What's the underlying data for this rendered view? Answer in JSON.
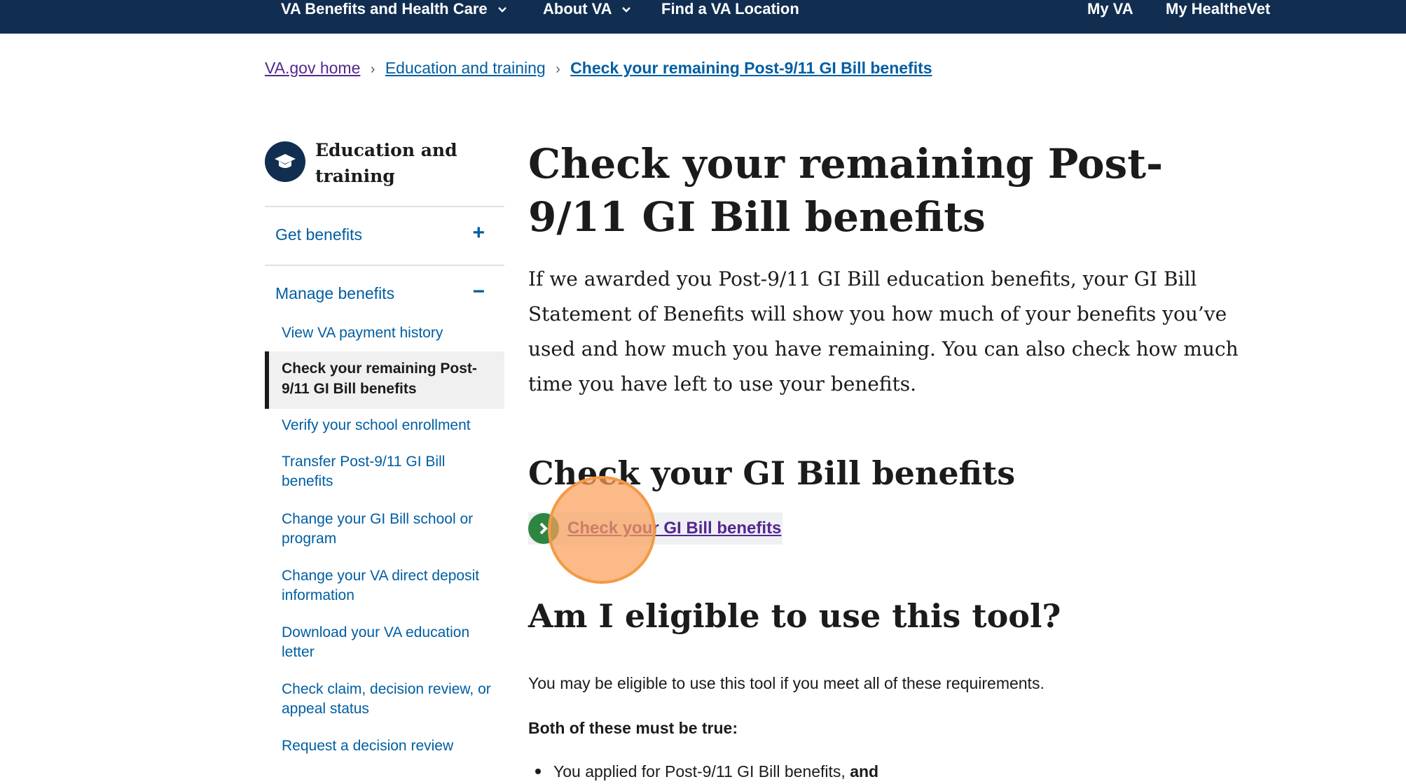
{
  "topnav": {
    "benefits_label": "VA Benefits and Health Care",
    "about_label": "About VA",
    "location_label": "Find a VA Location",
    "myva_label": "My VA",
    "myhealthevet_label": "My HealtheVet"
  },
  "breadcrumb": {
    "home": "VA.gov home",
    "section": "Education and training",
    "current": "Check your remaining Post-9/11 GI Bill benefits",
    "separator": "›"
  },
  "sidebar": {
    "title": "Education and training",
    "sections": [
      {
        "label": "Get benefits",
        "toggle": "+"
      },
      {
        "label": "Manage benefits",
        "toggle": "−"
      }
    ],
    "links": [
      "View VA payment history",
      "Check your remaining Post-9/11 GI Bill benefits",
      "Verify your school enrollment",
      "Transfer Post-9/11 GI Bill benefits",
      "Change your GI Bill school or program",
      "Change your VA direct deposit information",
      "Download your VA education letter",
      "Check claim, decision review, or appeal status",
      "Request a decision review"
    ]
  },
  "main": {
    "title": "Check your remaining Post-9/11 GI Bill benefits",
    "intro": "If we awarded you Post-9/11 GI Bill education benefits, your GI Bill Statement of Benefits will show you how much of your benefits you’ve used and how much you have remaining. You can also check how much time you have left to use your benefits.",
    "check_heading": "Check your GI Bill benefits",
    "action_link": "Check your GI Bill benefits",
    "eligible_heading": "Am I eligible to use this tool?",
    "eligible_text": "You may be eligible to use this tool if you meet all of these requirements.",
    "both_true": "Both of these must be true:",
    "bullet_1": "You applied for Post-9/11 GI Bill benefits,",
    "bullet_1_bold": "and"
  },
  "colors": {
    "nav_bg": "#112e51",
    "link": "#005ea2",
    "visited": "#54278f",
    "action_green": "#2e8540",
    "cursor_highlight": "#f39a45"
  },
  "icons": {
    "side_icon": "graduation-cap-icon",
    "action_icon": "chevron-right-circle-icon",
    "nav_chevron": "chevron-down-icon"
  }
}
